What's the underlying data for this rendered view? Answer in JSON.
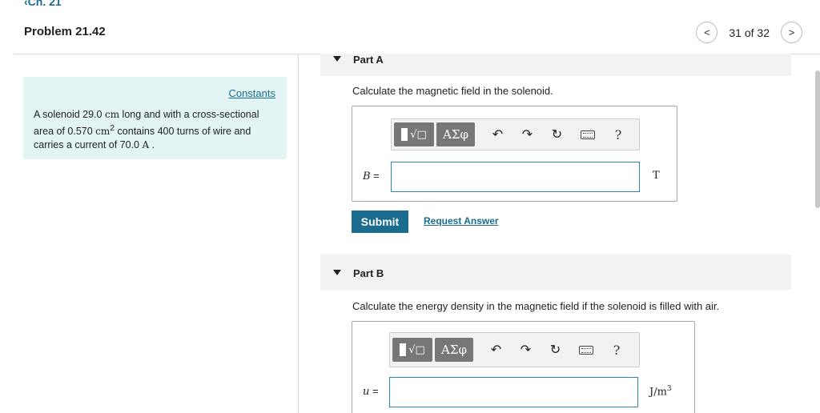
{
  "nav": {
    "back_label": "Ch. 21",
    "problem_title": "Problem 21.42",
    "pager_text": "31 of 32",
    "prev_label": "<",
    "next_label": ">"
  },
  "left_panel": {
    "constants_label": "Constants",
    "line1_pre": "A solenoid 29.0 ",
    "line1_unit": "cm",
    "line1_post": " long and with a cross-sectional",
    "line2_pre": "area of 0.570 ",
    "line2_unit": "cm",
    "line2_sup": "2",
    "line2_post": " contains 400 turns of wire and",
    "line3_pre": "carries a current of 70.0 ",
    "line3_unit": "A",
    "line3_post": " ."
  },
  "part_a": {
    "label": "Part A",
    "question": "Calculate the magnetic field in the solenoid.",
    "var_symbol": "B",
    "var_eq": " =",
    "input_value": "",
    "unit": "T",
    "greek_label": "ΑΣφ",
    "help_label": "?",
    "submit_label": "Submit",
    "request_label": "Request Answer"
  },
  "part_b": {
    "label": "Part B",
    "question": "Calculate the energy density in the magnetic field if the solenoid is filled with air.",
    "var_symbol": "u",
    "var_eq": " =",
    "input_value": "",
    "unit_base": "J/m",
    "unit_sup": "3",
    "greek_label": "ΑΣφ",
    "help_label": "?"
  },
  "icons": {
    "undo": "↶",
    "redo": "↷",
    "reset": "↻"
  },
  "colors": {
    "accent": "#1a6c8f",
    "panel_bg": "#e3f4f4",
    "input_border": "#2a86b4"
  }
}
